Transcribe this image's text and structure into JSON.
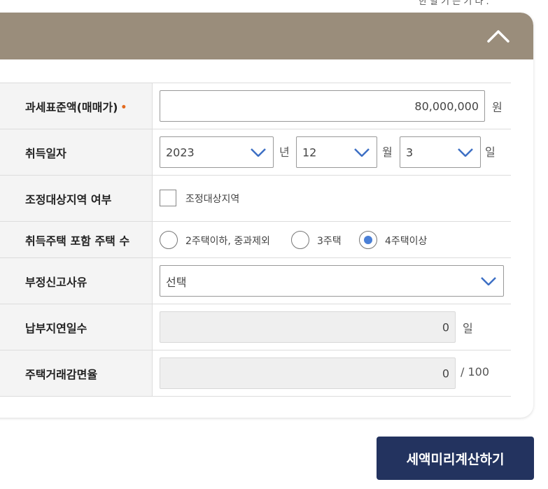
{
  "top_note": "한 말 기 는 기 다 .",
  "header": {
    "collapse_icon": "chevron-up-icon",
    "color": "#9a8d7b"
  },
  "rows": [
    {
      "label": "과세표준액(매매가)",
      "required_mark": "•",
      "value": "80,000,000",
      "unit": "원"
    },
    {
      "label": "취득일자",
      "year": "2023",
      "year_unit": "년",
      "month": "12",
      "month_unit": "월",
      "day": "3",
      "day_unit": "일"
    },
    {
      "label": "조정대상지역 여부",
      "checkbox_label": "조정대상지역",
      "checked": false
    },
    {
      "label": "취득주택 포함 주택 수",
      "options": [
        {
          "label": "2주택이하, 중과제외",
          "selected": false
        },
        {
          "label": "3주택",
          "selected": false
        },
        {
          "label": "4주택이상",
          "selected": true
        }
      ]
    },
    {
      "label": "부정신고사유",
      "selected": "선택"
    },
    {
      "label": "납부지연일수",
      "value": "0",
      "unit": "일"
    },
    {
      "label": "주택거래감면율",
      "value": "0",
      "unit": "/ 100"
    }
  ],
  "submit_label": "세액미리계산하기",
  "colors": {
    "accent_blue": "#4a7fd6",
    "button_navy": "#23335f",
    "required_orange": "#e36a1e"
  }
}
